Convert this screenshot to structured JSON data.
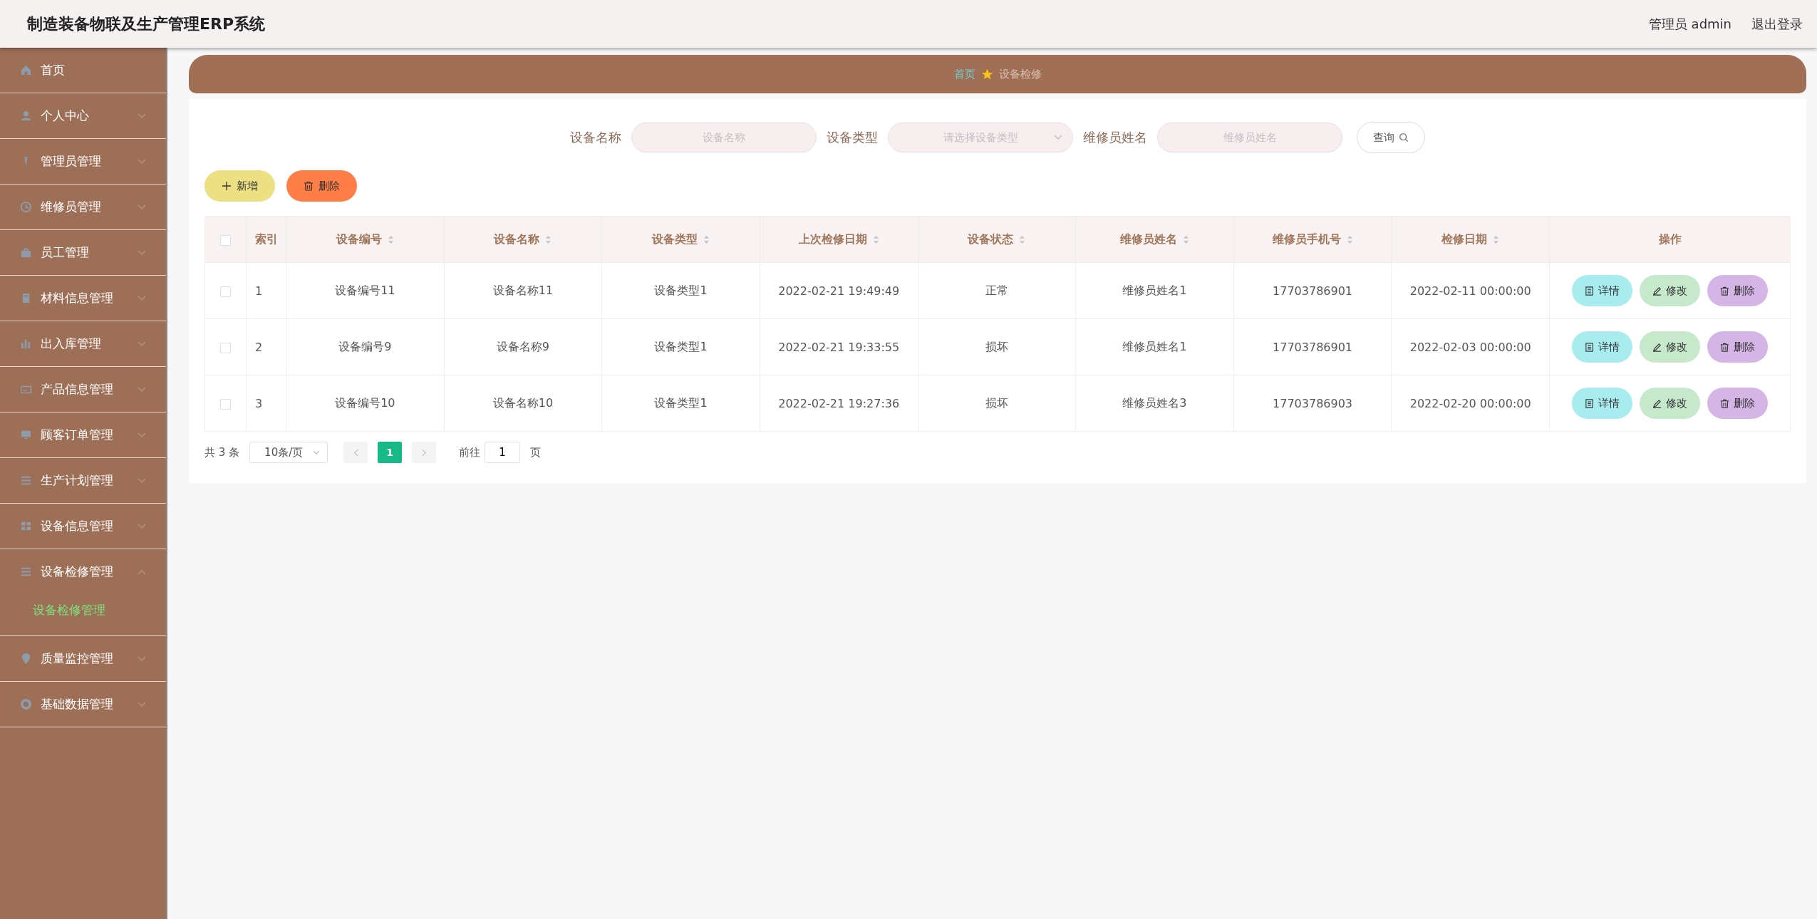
{
  "header": {
    "title": "制造装备物联及生产管理ERP系统",
    "user": "管理员 admin",
    "logout": "退出登录"
  },
  "sidebar": {
    "items": [
      {
        "label": "首页",
        "kind": "link"
      },
      {
        "label": "个人中心",
        "kind": "menu",
        "expanded": false
      },
      {
        "label": "管理员管理",
        "kind": "menu",
        "expanded": false
      },
      {
        "label": "维修员管理",
        "kind": "menu",
        "expanded": false
      },
      {
        "label": "员工管理",
        "kind": "menu",
        "expanded": false
      },
      {
        "label": "材料信息管理",
        "kind": "menu",
        "expanded": false
      },
      {
        "label": "出入库管理",
        "kind": "menu",
        "expanded": false
      },
      {
        "label": "产品信息管理",
        "kind": "menu",
        "expanded": false
      },
      {
        "label": "顾客订单管理",
        "kind": "menu",
        "expanded": false
      },
      {
        "label": "生产计划管理",
        "kind": "menu",
        "expanded": false
      },
      {
        "label": "设备信息管理",
        "kind": "menu",
        "expanded": false
      },
      {
        "label": "设备检修管理",
        "kind": "menu",
        "expanded": true,
        "children": [
          {
            "label": "设备检修管理",
            "selected": true
          }
        ]
      },
      {
        "label": "质量监控管理",
        "kind": "menu",
        "expanded": false
      },
      {
        "label": "基础数据管理",
        "kind": "menu",
        "expanded": false
      }
    ]
  },
  "breadcrumb": {
    "home": "首页",
    "current": "设备检修"
  },
  "search": {
    "fields": [
      {
        "label": "设备名称",
        "kind": "text",
        "placeholder": "设备名称"
      },
      {
        "label": "设备类型",
        "kind": "select",
        "placeholder": "请选择设备类型"
      },
      {
        "label": "维修员姓名",
        "kind": "text",
        "placeholder": "维修员姓名"
      }
    ],
    "button": "查询"
  },
  "actions": [
    {
      "label": "新增",
      "kind": "add"
    },
    {
      "label": "删除",
      "kind": "delete"
    }
  ],
  "table": {
    "header_checked": false,
    "columns": [
      {
        "label": "索引",
        "sortable": false
      },
      {
        "label": "设备编号",
        "sortable": true
      },
      {
        "label": "设备名称",
        "sortable": true
      },
      {
        "label": "设备类型",
        "sortable": true
      },
      {
        "label": "上次检修日期",
        "sortable": true
      },
      {
        "label": "设备状态",
        "sortable": true
      },
      {
        "label": "维修员姓名",
        "sortable": true
      },
      {
        "label": "维修员手机号",
        "sortable": true
      },
      {
        "label": "检修日期",
        "sortable": true
      },
      {
        "label": "操作",
        "sortable": false
      }
    ],
    "rows": [
      {
        "checked": false,
        "cells": [
          "1",
          "设备编号11",
          "设备名称11",
          "设备类型1",
          "2022-02-21 19:49:49",
          "正常",
          "维修员姓名1",
          "17703786901",
          "2022-02-11 00:00:00"
        ],
        "buttons": [
          {
            "label": "详情",
            "kind": "detail"
          },
          {
            "label": "修改",
            "kind": "edit"
          },
          {
            "label": "删除",
            "kind": "delete"
          }
        ]
      },
      {
        "checked": false,
        "cells": [
          "2",
          "设备编号9",
          "设备名称9",
          "设备类型1",
          "2022-02-21 19:33:55",
          "损坏",
          "维修员姓名1",
          "17703786901",
          "2022-02-03 00:00:00"
        ],
        "buttons": [
          {
            "label": "详情",
            "kind": "detail"
          },
          {
            "label": "修改",
            "kind": "edit"
          },
          {
            "label": "删除",
            "kind": "delete"
          }
        ]
      },
      {
        "checked": false,
        "cells": [
          "3",
          "设备编号10",
          "设备名称10",
          "设备类型1",
          "2022-02-21 19:27:36",
          "损坏",
          "维修员姓名3",
          "17703786903",
          "2022-02-20 00:00:00"
        ],
        "buttons": [
          {
            "label": "详情",
            "kind": "detail"
          },
          {
            "label": "修改",
            "kind": "edit"
          },
          {
            "label": "删除",
            "kind": "delete"
          }
        ]
      }
    ]
  },
  "pagination": {
    "total": "共 3 条",
    "page_size": "10条/页",
    "pages": [
      {
        "label": "1",
        "selected": true
      }
    ],
    "goto": "前往",
    "goto_value": "1",
    "goto_unit": "页"
  }
}
